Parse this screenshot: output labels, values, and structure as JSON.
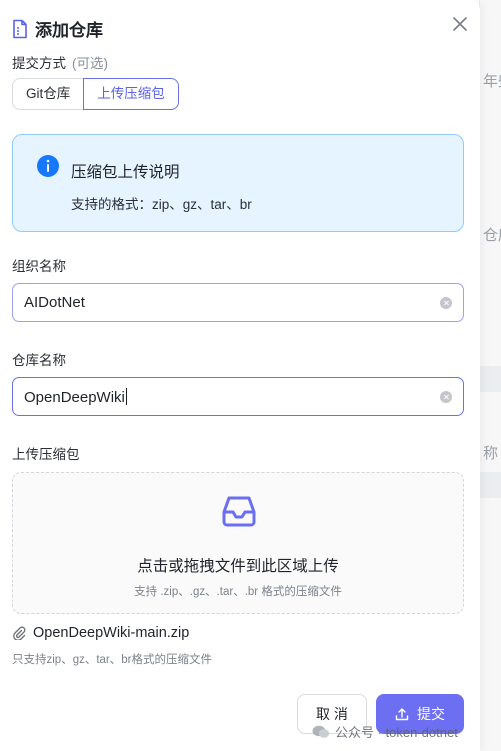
{
  "dialog": {
    "title": "添加仓库",
    "close_icon": "close-icon"
  },
  "submit_method": {
    "label": "提交方式",
    "optional": "(可选)",
    "options": [
      "Git仓库",
      "上传压缩包"
    ],
    "selected": "上传压缩包"
  },
  "info": {
    "icon": "info-icon",
    "title": "压缩包上传说明",
    "desc": "支持的格式：zip、gz、tar、br",
    "colors": {
      "background": "#e6f4ff",
      "border": "#91caff",
      "icon": "#1677ff"
    }
  },
  "org": {
    "label": "组织名称",
    "value": "AIDotNet"
  },
  "repo": {
    "label": "仓库名称",
    "value": "OpenDeepWiki"
  },
  "upload": {
    "label": "上传压缩包",
    "icon": "inbox-icon",
    "title": "点击或拖拽文件到此区域上传",
    "hint": "支持 .zip、.gz、.tar、.br 格式的压缩文件",
    "file_name": "OpenDeepWiki-main.zip",
    "help": "只支持zip、gz、tar、br格式的压缩文件"
  },
  "actions": {
    "cancel": "取 消",
    "submit": "提交",
    "accent": "#6c6ff2"
  },
  "watermark": {
    "text": "公众号 · token-dotnet"
  },
  "background_page": {
    "chars": [
      "年些",
      "仓库",
      "称"
    ]
  }
}
